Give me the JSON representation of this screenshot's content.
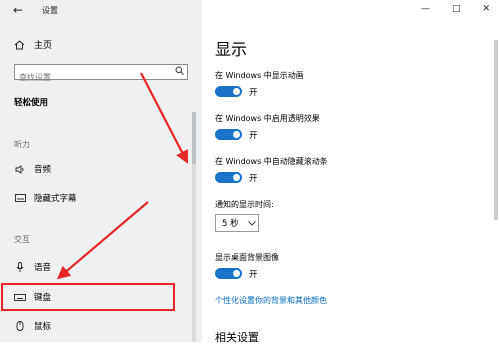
{
  "app": {
    "back_symbol": "←",
    "title": "设置",
    "window_controls": {
      "minimize": "—",
      "maximize": "□",
      "close": "✕"
    }
  },
  "sidebar": {
    "home_label": "主页",
    "search_placeholder": "查找设置",
    "section_title": "轻松使用",
    "groups": [
      {
        "label": "听力"
      },
      {
        "label": "交互"
      }
    ],
    "items": [
      {
        "label": "音频",
        "icon": "speaker-icon"
      },
      {
        "label": "隐藏式字幕",
        "icon": "captions-icon"
      },
      {
        "label": "语音",
        "icon": "microphone-icon"
      },
      {
        "label": "键盘",
        "icon": "keyboard-icon"
      },
      {
        "label": "鼠标",
        "icon": "mouse-icon"
      }
    ],
    "highlight_color": "#e8262a"
  },
  "main": {
    "title": "显示",
    "settings": [
      {
        "label": "在 Windows 中显示动画",
        "state": "开"
      },
      {
        "label": "在 Windows 中启用透明效果",
        "state": "开"
      },
      {
        "label": "在 Windows 中自动隐藏滚动条",
        "state": "开"
      }
    ],
    "notification_label": "通知的显示时间:",
    "notification_value": "5 秒",
    "wallpaper_label": "显示桌面背景图像",
    "wallpaper_state": "开",
    "link": "个性化设置你的背景和其他颜色",
    "related_title": "相关设置"
  },
  "colors": {
    "accent": "#1a73c8",
    "arrow": "#e8262a"
  }
}
